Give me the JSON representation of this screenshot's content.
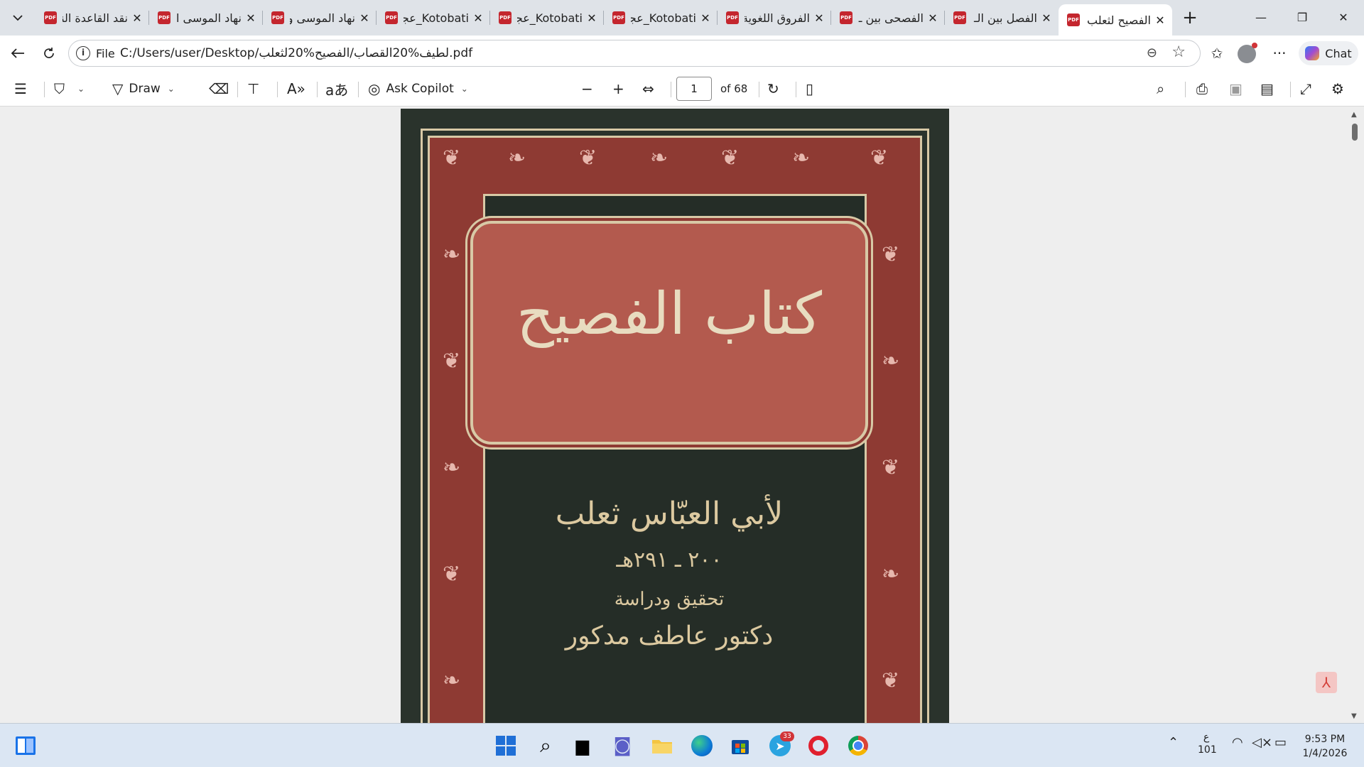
{
  "browser": {
    "tabs": [
      {
        "label": "نقد القاعدة النـ",
        "active": false
      },
      {
        "label": "نهاد الموسى الـ",
        "active": false
      },
      {
        "label": "نهاد الموسى و",
        "active": false
      },
      {
        "label": "Kotobati_عجاز",
        "active": false
      },
      {
        "label": "Kotobati_عجاز",
        "active": false
      },
      {
        "label": "Kotobati_عجاز",
        "active": false
      },
      {
        "label": "الفروق اللغوية",
        "active": false
      },
      {
        "label": "الفصحى بين ـ",
        "active": false
      },
      {
        "label": "الفصل بين الـ",
        "active": false
      },
      {
        "label": "الفصيح لثعلب",
        "active": true
      }
    ],
    "pdf_badge": "PDF",
    "file_label": "File",
    "url": "C:/Users/user/Desktop/لطيف%20القصاب/الفصيح%20لثعلب.pdf",
    "chat_label": "Chat"
  },
  "pdf_toolbar": {
    "draw_label": "Draw",
    "ask_copilot_label": "Ask Copilot",
    "page_number": "1",
    "page_of": "of 68"
  },
  "cover": {
    "title": "كتاب الفصيح",
    "author": "لأبي العبّاس ثعلب",
    "dates": "٢٠٠ ـ ٢٩١هـ",
    "tahqiq": "تحقيق ودراسة",
    "editor": "دكتور عاطف مدكور"
  },
  "taskbar": {
    "telegram_badge": "33",
    "ime_char": "ع",
    "ime_num": "101",
    "time": "9:53 PM",
    "date": "1/4/2026"
  },
  "colors": {
    "tabstrip": "#dfe3e8",
    "cover_red": "#8e3a33",
    "cover_gold": "#d8c9a6",
    "cover_dark": "#252d27",
    "taskbar": "#dbe6f3"
  }
}
